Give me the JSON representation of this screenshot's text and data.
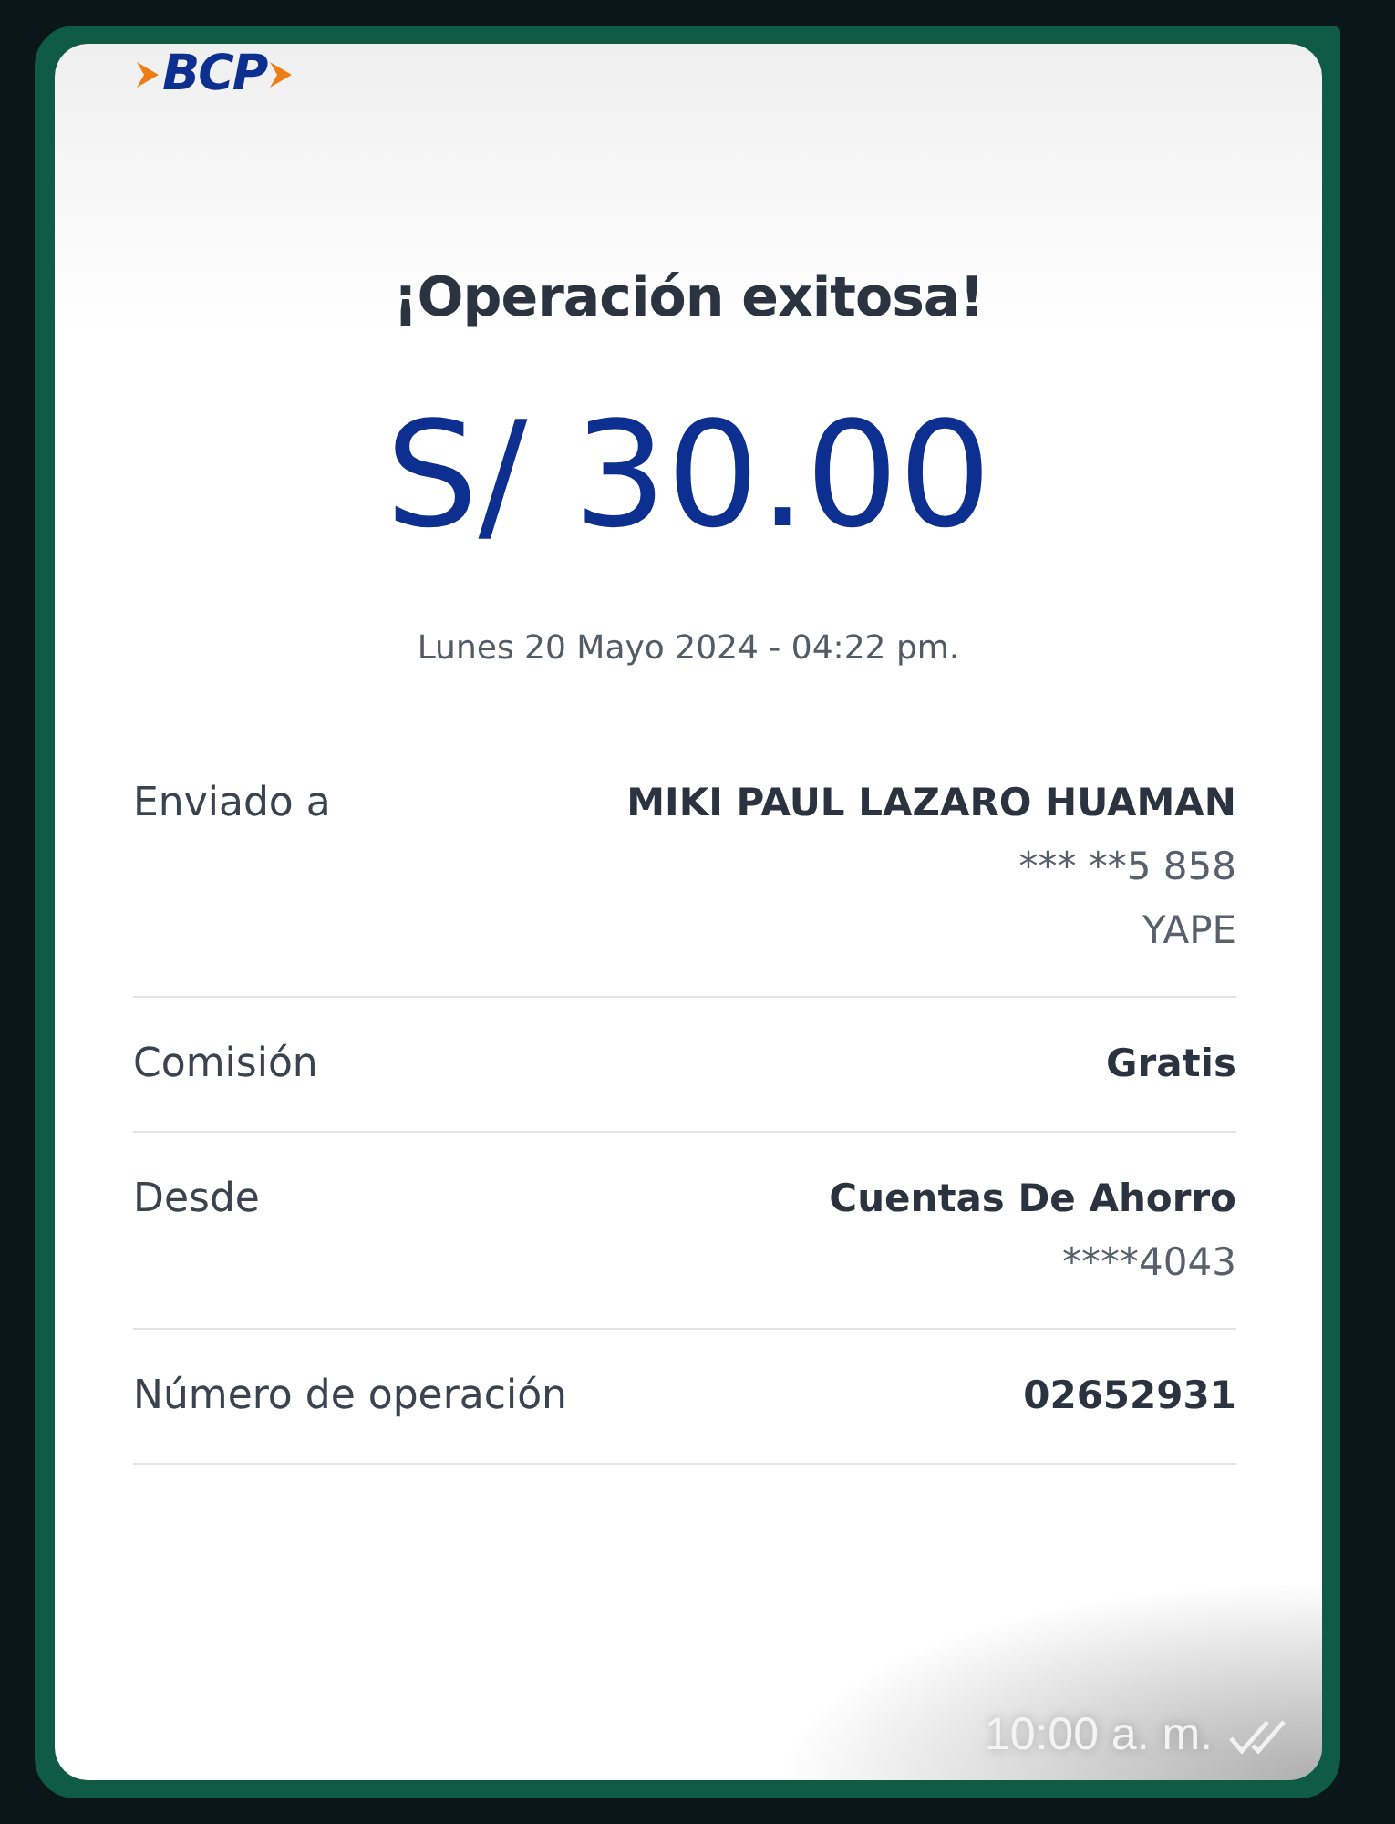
{
  "receipt": {
    "brand": "BCP",
    "title": "¡Operación exitosa!",
    "amount": "S/ 30.00",
    "datetime": "Lunes 20 Mayo 2024 - 04:22 pm.",
    "rows": [
      {
        "label": "Enviado a",
        "values": [
          {
            "text": "MIKI PAUL LAZARO HUAMAN",
            "bold": true
          },
          {
            "text": "*** **5 858",
            "bold": false
          },
          {
            "text": "YAPE",
            "bold": false
          }
        ]
      },
      {
        "label": "Comisión",
        "values": [
          {
            "text": "Gratis",
            "bold": true
          }
        ]
      },
      {
        "label": "Desde",
        "values": [
          {
            "text": "Cuentas De Ahorro",
            "bold": true
          },
          {
            "text": "****4043",
            "bold": false
          }
        ]
      },
      {
        "label": "Número de operación",
        "values": [
          {
            "text": "02652931",
            "bold": true
          }
        ]
      }
    ]
  },
  "message": {
    "time": "10:00 a. m."
  }
}
